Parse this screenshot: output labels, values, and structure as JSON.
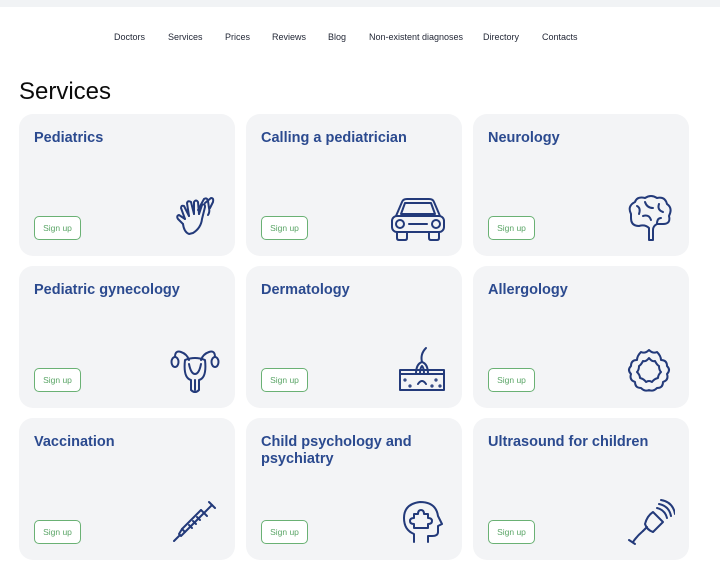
{
  "nav": {
    "items": [
      "Doctors",
      "Services",
      "Prices",
      "Reviews",
      "Blog",
      "Non-existent diagnoses",
      "Directory",
      "Contacts"
    ]
  },
  "page": {
    "title": "Services"
  },
  "cards": [
    {
      "title": "Pediatrics",
      "button": "Sign up",
      "icon": "hand-icon"
    },
    {
      "title": "Calling a pediatrician",
      "button": "Sign up",
      "icon": "car-icon"
    },
    {
      "title": "Neurology",
      "button": "Sign up",
      "icon": "brain-icon"
    },
    {
      "title": "Pediatric gynecology",
      "button": "Sign up",
      "icon": "uterus-icon"
    },
    {
      "title": "Dermatology",
      "button": "Sign up",
      "icon": "skin-hair-icon"
    },
    {
      "title": "Allergology",
      "button": "Sign up",
      "icon": "allergen-icon"
    },
    {
      "title": "Vaccination",
      "button": "Sign up",
      "icon": "syringe-icon"
    },
    {
      "title": "Child psychology and psychiatry",
      "button": "Sign up",
      "icon": "head-puzzle-icon"
    },
    {
      "title": "Ultrasound for children",
      "button": "Sign up",
      "icon": "ultrasound-probe-icon"
    }
  ],
  "colors": {
    "accent": "#2b4a8f",
    "icon": "#233a7a",
    "button_border": "#6ab174",
    "card_bg": "#f3f4f6"
  }
}
